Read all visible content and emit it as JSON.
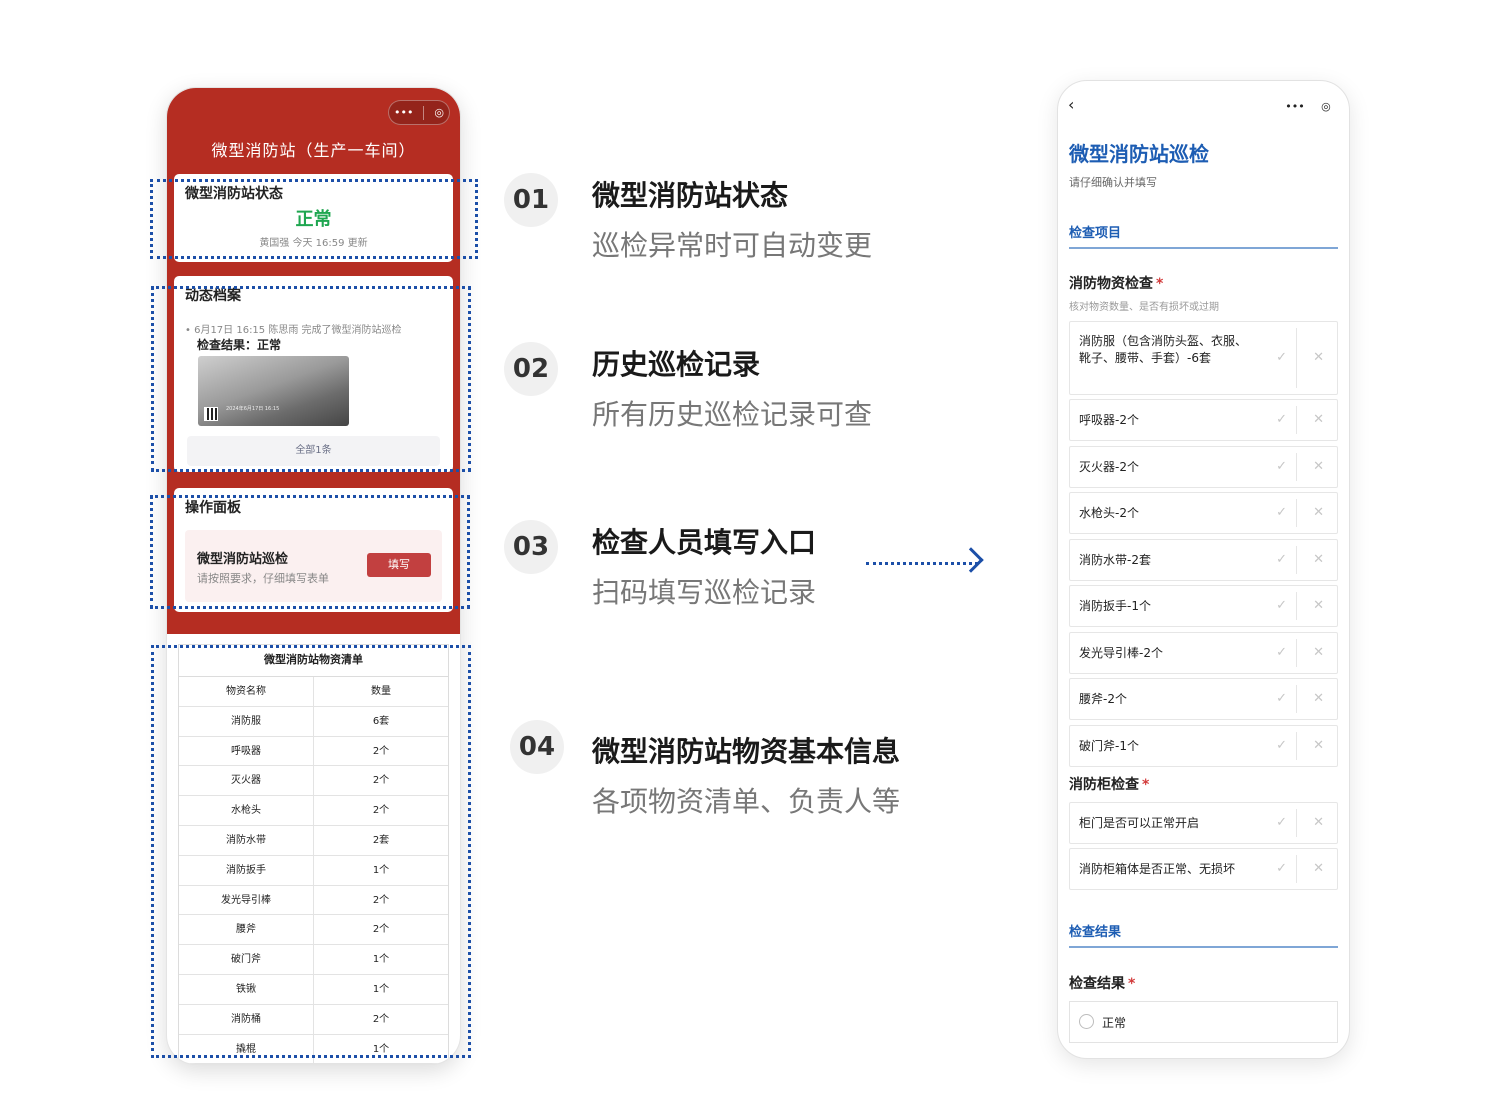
{
  "left_phone": {
    "title": "微型消防站（生产一车间）",
    "capsule_more": "•••",
    "capsule_close": "◎",
    "status_card": {
      "heading": "微型消防站状态",
      "value": "正常",
      "meta": "黄国强 今天 16:59 更新",
      "value_color": "#1fa650"
    },
    "archive_card": {
      "heading": "动态档案",
      "log_line": "•  6月17日 16:15  陈思雨 完成了微型消防站巡检",
      "result": "检查结果：正常",
      "photo_stamp": "2024年6月17日 16:15",
      "more_label": "全部1条"
    },
    "panel_card": {
      "heading": "操作面板",
      "action_title": "微型消防站巡检",
      "action_sub": "请按照要求，仔细填写表单",
      "action_button": "填写"
    },
    "inventory": {
      "title": "微型消防站物资清单",
      "headers": [
        "物资名称",
        "数量"
      ],
      "rows": [
        [
          "消防服",
          "6套"
        ],
        [
          "呼吸器",
          "2个"
        ],
        [
          "灭火器",
          "2个"
        ],
        [
          "水枪头",
          "2个"
        ],
        [
          "消防水带",
          "2套"
        ],
        [
          "消防扳手",
          "1个"
        ],
        [
          "发光导引棒",
          "2个"
        ],
        [
          "腰斧",
          "2个"
        ],
        [
          "破门斧",
          "1个"
        ],
        [
          "铁锹",
          "1个"
        ],
        [
          "消防桶",
          "2个"
        ],
        [
          "撬棍",
          "1个"
        ]
      ]
    }
  },
  "features": [
    {
      "num": "01",
      "title": "微型消防站状态",
      "desc": "巡检异常时可自动变更"
    },
    {
      "num": "02",
      "title": "历史巡检记录",
      "desc": "所有历史巡检记录可查"
    },
    {
      "num": "03",
      "title": "检查人员填写入口",
      "desc": "扫码填写巡检记录"
    },
    {
      "num": "04",
      "title": "微型消防站物资基本信息",
      "desc": "各项物资清单、负责人等"
    }
  ],
  "right_phone": {
    "back": "‹",
    "capsule_more": "•••",
    "capsule_close": "◎",
    "title": "微型消防站巡检",
    "subtitle": "请仔细确认并填写",
    "section_items": "检查项目",
    "q1_label": "消防物资检查",
    "q1_hint": "核对物资数量、是否有损坏或过期",
    "q1_items": [
      "消防服（包含消防头盔、衣服、靴子、腰带、手套）-6套",
      "呼吸器-2个",
      "灭火器-2个",
      "水枪头-2个",
      "消防水带-2套",
      "消防扳手-1个",
      "发光导引棒-2个",
      "腰斧-2个",
      "破门斧-1个"
    ],
    "q2_label": "消防柜检查",
    "q2_items": [
      "柜门是否可以正常开启",
      "消防柜箱体是否正常、无损坏"
    ],
    "section_result": "检查结果",
    "q3_label": "检查结果",
    "q3_option": "正常",
    "required_mark": "*",
    "ok_mark": "✓",
    "no_mark": "✕",
    "accent_color": "#1d5db3"
  }
}
